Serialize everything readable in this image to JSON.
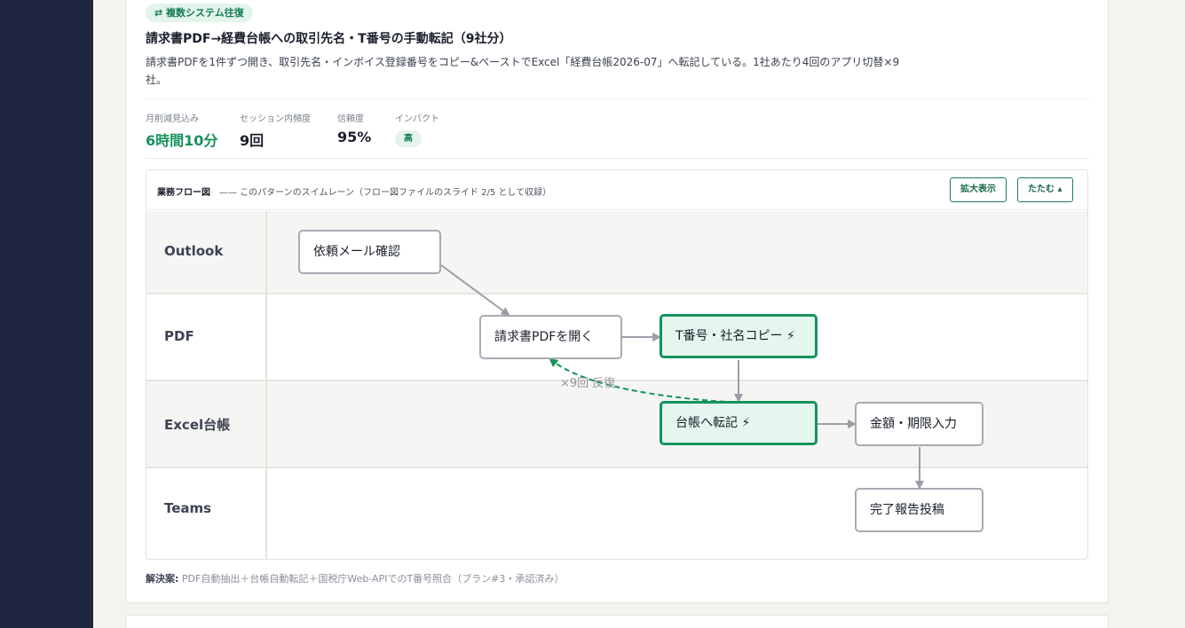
{
  "pattern": {
    "badge": "⇄ 複数システム往復",
    "title": "請求書PDF→経費台帳への取引先名・T番号の手動転記（9社分）",
    "description": "請求書PDFを1件ずつ開き、取引先名・インボイス登録番号をコピー&ペーストでExcel「経費台帳2026-07」へ転記している。1社あたり4回のアプリ切替×9社。"
  },
  "metrics": [
    {
      "label": "月削減見込み",
      "value": "6時間10分"
    },
    {
      "label": "セッション内頻度",
      "value": "9回"
    },
    {
      "label": "信頼度",
      "value": "95%"
    },
    {
      "label": "インパクト",
      "value": "高"
    }
  ],
  "flow": {
    "title": "業務フロー図",
    "subtitle": "—— このパターンのスイムレーン（フロー図ファイルのスライド 2/5 として収録）",
    "expand_label": "拡大表示",
    "collapse_label": "たたむ ▴",
    "lanes": [
      "Outlook",
      "PDF",
      "Excel台帳",
      "Teams"
    ],
    "nodes": {
      "mail": "依頼メール確認",
      "open_pdf": "請求書PDFを開く",
      "copy": "T番号・社名コピー ⚡",
      "transcribe": "台帳へ転記 ⚡",
      "amount": "金額・期限入力",
      "report": "完了報告投稿"
    },
    "loop_label": "×9回 反復",
    "colors": {
      "highlight": "#15935a",
      "arrow": "#9a9ea6"
    }
  },
  "solution": {
    "label": "解決案:",
    "text": "PDF自動抽出＋台帳自動転記＋国税庁Web-APIでのT番号照合（プラン#3・承認済み）"
  }
}
